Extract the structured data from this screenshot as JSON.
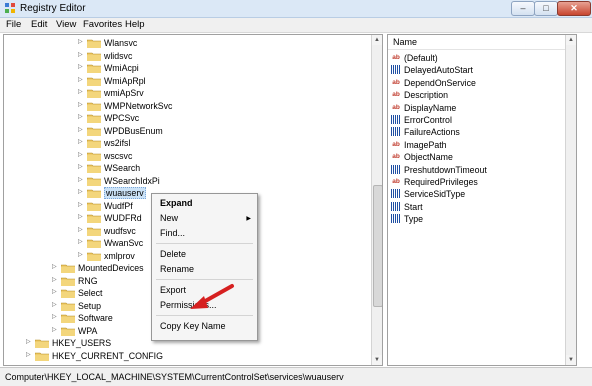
{
  "window": {
    "title": "Registry Editor",
    "minimize": "–",
    "maximize": "□",
    "close": "✕"
  },
  "menu": [
    "File",
    "Edit",
    "View",
    "Favorites",
    "Help"
  ],
  "tree": {
    "services_children": [
      "Wlansvc",
      "wlidsvc",
      "WmiAcpi",
      "WmiApRpl",
      "wmiApSrv",
      "WMPNetworkSvc",
      "WPCSvc",
      "WPDBusEnum",
      "ws2ifsl",
      "wscsvc",
      "WSearch",
      "WSearchIdxPi",
      "wuauserv",
      "WudfPf",
      "WUDFRd",
      "wudfsvc",
      "WwanSvc",
      "xmlprov"
    ],
    "controlset_children": [
      "MountedDevices",
      "RNG",
      "Select",
      "Setup",
      "Software",
      "WPA"
    ],
    "root_keys": [
      "HKEY_USERS",
      "HKEY_CURRENT_CONFIG"
    ],
    "selected": "wuauserv"
  },
  "values_pane": {
    "column_name": "Name",
    "values": [
      {
        "name": "(Default)",
        "icon": "ab"
      },
      {
        "name": "DelayedAutoStart",
        "icon": "bin"
      },
      {
        "name": "DependOnService",
        "icon": "ab"
      },
      {
        "name": "Description",
        "icon": "ab"
      },
      {
        "name": "DisplayName",
        "icon": "ab"
      },
      {
        "name": "ErrorControl",
        "icon": "bin"
      },
      {
        "name": "FailureActions",
        "icon": "bin"
      },
      {
        "name": "ImagePath",
        "icon": "ab"
      },
      {
        "name": "ObjectName",
        "icon": "ab"
      },
      {
        "name": "PreshutdownTimeout",
        "icon": "bin"
      },
      {
        "name": "RequiredPrivileges",
        "icon": "ab"
      },
      {
        "name": "ServiceSidType",
        "icon": "bin"
      },
      {
        "name": "Start",
        "icon": "bin"
      },
      {
        "name": "Type",
        "icon": "bin"
      }
    ]
  },
  "context_menu": {
    "expand": "Expand",
    "new": "New",
    "find": "Find...",
    "delete": "Delete",
    "rename": "Rename",
    "export": "Export",
    "permissions": "Permissions...",
    "copy_key_name": "Copy Key Name"
  },
  "status_bar": "Computer\\HKEY_LOCAL_MACHINE\\SYSTEM\\CurrentControlSet\\services\\wuauserv",
  "colors": {
    "accent_arrow": "#d62020",
    "folder": "#e8c15a",
    "selection": "#cbe2f7"
  },
  "icons": {
    "value_string": "ab-icon",
    "value_binary": "binary-value-icon",
    "folder": "folder-icon"
  }
}
